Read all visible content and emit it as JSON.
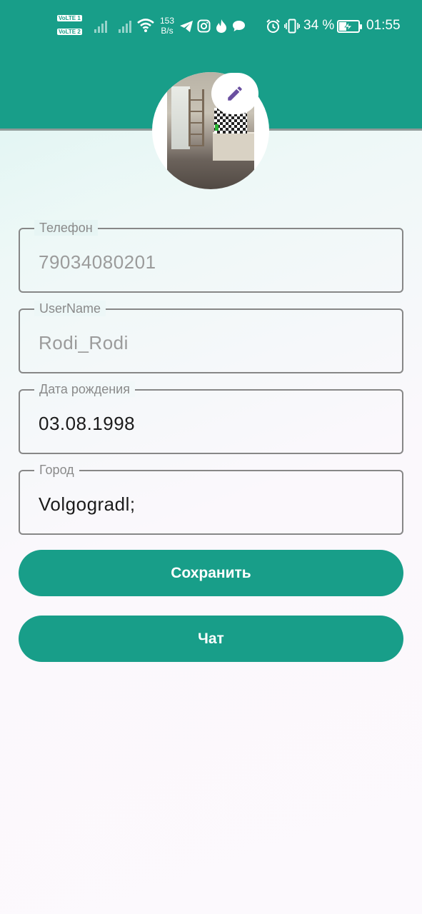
{
  "colors": {
    "accent": "#189e89",
    "header_border": "#8f9a98",
    "field_border": "#878787",
    "edit_icon": "#6a4fa0"
  },
  "status_bar": {
    "volte_1": "VoLTE 1",
    "volte_2": "VoLTE 2",
    "network_speed_value": "153",
    "network_speed_unit": "B/s",
    "battery_percent": "34 %",
    "time": "01:55",
    "icons": [
      "signal-icon",
      "signal-icon",
      "wifi-icon",
      "telegram-icon",
      "instagram-icon",
      "flame-icon",
      "chat-bubble-icon",
      "alarm-icon",
      "vibrate-icon",
      "battery-charging-icon"
    ]
  },
  "profile": {
    "avatar_icon": "profile-photo",
    "edit_icon": "pencil-icon"
  },
  "fields": {
    "phone": {
      "label": "Телефон",
      "value": "79034080201"
    },
    "username": {
      "label": "UserName",
      "value": "Rodi_Rodi"
    },
    "birthdate": {
      "label": "Дата рождения",
      "value": "03.08.1998"
    },
    "city": {
      "label": "Город",
      "value": "Volgogradl;"
    }
  },
  "buttons": {
    "save_label": "Сохранить",
    "chat_label": "Чат"
  }
}
